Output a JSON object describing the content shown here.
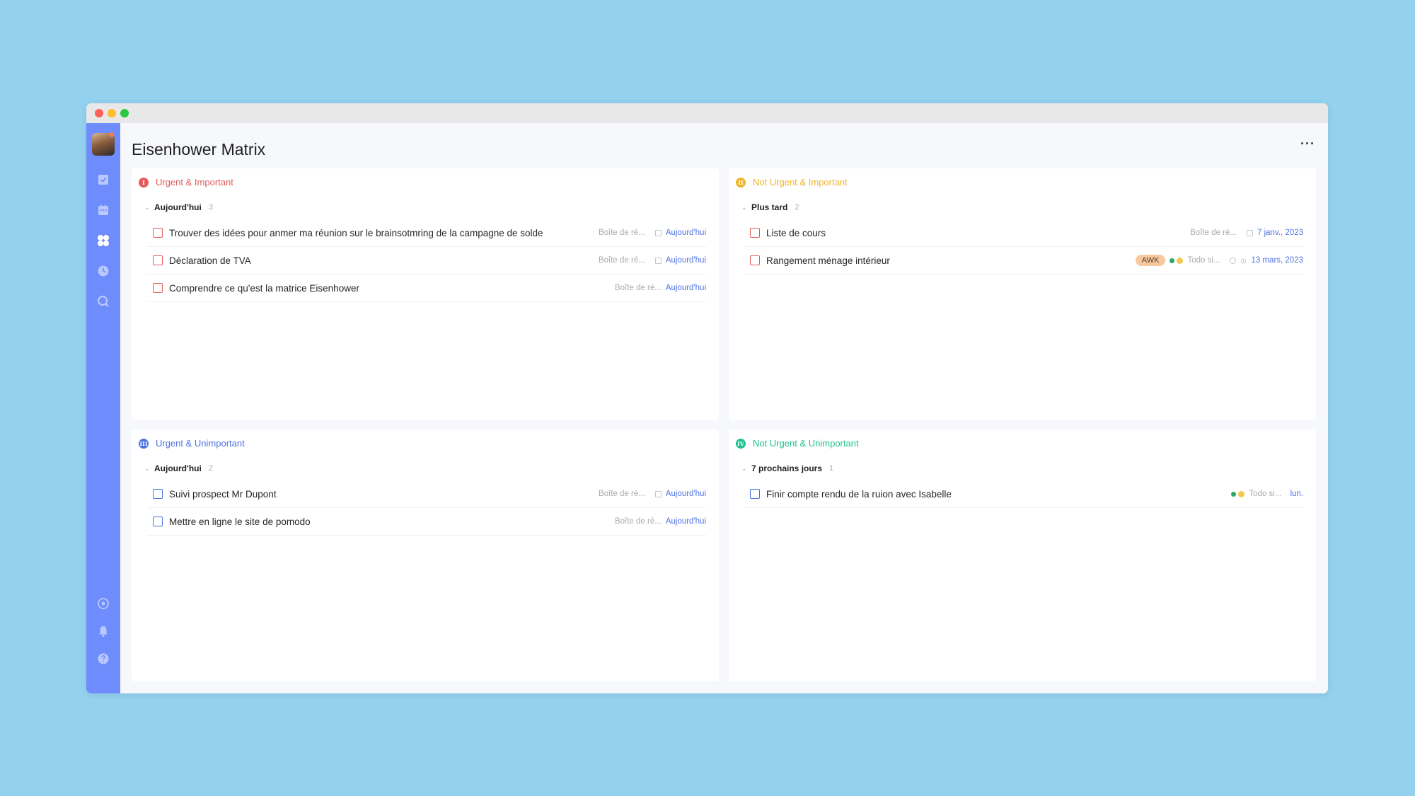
{
  "page": {
    "title": "Eisenhower Matrix",
    "more_label": "···"
  },
  "colors": {
    "sidebar": "#6e8cfb",
    "red": "#e35b5b",
    "yellow": "#f0b429",
    "blue": "#4f72e3",
    "green": "#1fbf8f",
    "link": "#4f72e3"
  },
  "sidebar": {
    "icons": [
      "checkbox-icon",
      "calendar-icon",
      "matrix-icon",
      "clock-icon",
      "search-icon",
      "sync-icon",
      "bell-icon",
      "help-icon"
    ]
  },
  "quadrants": [
    {
      "badge": "I",
      "title": "Urgent & Important",
      "group": {
        "name": "Aujourd'hui",
        "count": "3"
      },
      "tasks": [
        {
          "title": "Trouver des idées pour anmer ma réunion sur le brainsotmring de la campagne de solde",
          "project": "Boîte de ré...",
          "date": "Aujourd'hui"
        },
        {
          "title": "Déclaration de TVA",
          "project": "Boîte de ré...",
          "date": "Aujourd'hui"
        },
        {
          "title": "Comprendre ce qu'est la matrice Eisenhower",
          "project": "Boîte de ré...",
          "date": "Aujourd'hui"
        }
      ]
    },
    {
      "badge": "II",
      "title": "Not Urgent & Important",
      "group": {
        "name": "Plus tard",
        "count": "2"
      },
      "tasks": [
        {
          "title": "Liste de cours",
          "project": "Boîte de ré...",
          "date": "7 janv., 2023"
        },
        {
          "title": "Rangement ménage intérieur",
          "tag": "AWK",
          "project": "Todo si...",
          "date": "13 mars, 2023"
        }
      ]
    },
    {
      "badge": "III",
      "title": "Urgent & Unimportant",
      "group": {
        "name": "Aujourd'hui",
        "count": "2"
      },
      "tasks": [
        {
          "title": "Suivi prospect Mr Dupont",
          "project": "Boîte de ré...",
          "date": "Aujourd'hui"
        },
        {
          "title": "Mettre en ligne le site de pomodo",
          "project": "Boîte de ré...",
          "date": "Aujourd'hui"
        }
      ]
    },
    {
      "badge": "IV",
      "title": "Not Urgent & Unimportant",
      "group": {
        "name": "7 prochains jours",
        "count": "1"
      },
      "tasks": [
        {
          "title": "Finir compte rendu de la ruion avec Isabelle",
          "project": "Todo si...",
          "date": "lun."
        }
      ]
    }
  ]
}
